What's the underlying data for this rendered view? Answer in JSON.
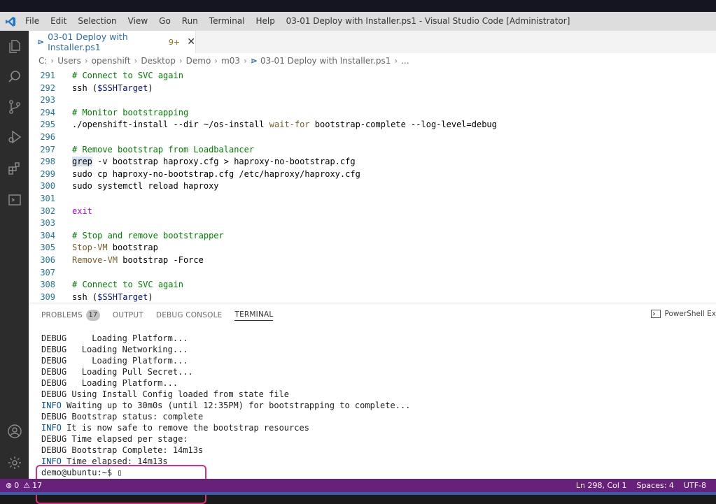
{
  "window": {
    "title": "03-01 Deploy with Installer.ps1 - Visual Studio Code [Administrator]",
    "menu": [
      "File",
      "Edit",
      "Selection",
      "View",
      "Go",
      "Run",
      "Terminal",
      "Help"
    ]
  },
  "activity_bar": {
    "items": [
      "explorer-icon",
      "search-icon",
      "source-control-icon",
      "run-debug-icon",
      "extensions-icon",
      "remote-terminal-icon"
    ],
    "bottom": [
      "accounts-icon",
      "manage-gear-icon"
    ]
  },
  "tab": {
    "ps_glyph": "⋗",
    "name": "03-01 Deploy with Installer.ps1",
    "badge": "9+",
    "close": "✕"
  },
  "breadcrumb": [
    "C:",
    "Users",
    "openshift",
    "Desktop",
    "Demo",
    "m03",
    "03-01 Deploy with Installer.ps1",
    "..."
  ],
  "code_lines": [
    {
      "n": "291",
      "segments": [
        {
          "t": "# Connect to SVC again",
          "c": "c-comment"
        }
      ]
    },
    {
      "n": "292",
      "segments": [
        {
          "t": "ssh (",
          "c": ""
        },
        {
          "t": "$SSHTarget",
          "c": "c-var"
        },
        {
          "t": ")",
          "c": ""
        }
      ]
    },
    {
      "n": "293",
      "segments": []
    },
    {
      "n": "294",
      "segments": [
        {
          "t": "# Monitor bootstrapping",
          "c": "c-comment"
        }
      ]
    },
    {
      "n": "295",
      "segments": [
        {
          "t": "./openshift-install --dir ~/os-install ",
          "c": ""
        },
        {
          "t": "wait-for",
          "c": "c-fn"
        },
        {
          "t": " bootstrap-complete --log-level=debug",
          "c": ""
        }
      ]
    },
    {
      "n": "296",
      "segments": []
    },
    {
      "n": "297",
      "segments": [
        {
          "t": "# Remove bootstrap from Loadbalancer",
          "c": "c-comment"
        }
      ]
    },
    {
      "n": "298",
      "segments": [
        {
          "t": "grep",
          "c": "hl"
        },
        {
          "t": " -v bootstrap haproxy.cfg > haproxy-no-bootstrap.cfg",
          "c": ""
        }
      ]
    },
    {
      "n": "299",
      "segments": [
        {
          "t": "sudo cp haproxy-no-bootstrap.cfg /etc/haproxy/haproxy.cfg",
          "c": ""
        }
      ]
    },
    {
      "n": "300",
      "segments": [
        {
          "t": "sudo systemctl reload haproxy",
          "c": ""
        }
      ]
    },
    {
      "n": "301",
      "segments": []
    },
    {
      "n": "302",
      "segments": [
        {
          "t": "exit",
          "c": "c-kw"
        }
      ]
    },
    {
      "n": "303",
      "segments": []
    },
    {
      "n": "304",
      "segments": [
        {
          "t": "# Stop and remove bootstrapper",
          "c": "c-comment"
        }
      ]
    },
    {
      "n": "305",
      "segments": [
        {
          "t": "Stop-VM",
          "c": "c-fn"
        },
        {
          "t": " bootstrap",
          "c": ""
        }
      ]
    },
    {
      "n": "306",
      "segments": [
        {
          "t": "Remove-VM",
          "c": "c-fn"
        },
        {
          "t": " bootstrap -Force",
          "c": ""
        }
      ]
    },
    {
      "n": "307",
      "segments": []
    },
    {
      "n": "308",
      "segments": [
        {
          "t": "# Connect to SVC again",
          "c": "c-comment"
        }
      ]
    },
    {
      "n": "309",
      "segments": [
        {
          "t": "ssh (",
          "c": ""
        },
        {
          "t": "$SSHTarget",
          "c": "c-var"
        },
        {
          "t": ")",
          "c": ""
        }
      ]
    }
  ],
  "panel": {
    "tabs": [
      {
        "label": "PROBLEMS",
        "count": "17"
      },
      {
        "label": "OUTPUT"
      },
      {
        "label": "DEBUG CONSOLE"
      },
      {
        "label": "TERMINAL",
        "active": true
      }
    ],
    "shell_label": "PowerShell Ex"
  },
  "terminal_lines": [
    {
      "level": "DEBUG",
      "text": "     Loading Platform..."
    },
    {
      "level": "DEBUG",
      "text": "   Loading Networking..."
    },
    {
      "level": "DEBUG",
      "text": "     Loading Platform..."
    },
    {
      "level": "DEBUG",
      "text": "   Loading Pull Secret..."
    },
    {
      "level": "DEBUG",
      "text": "   Loading Platform..."
    },
    {
      "level": "DEBUG",
      "text": " Using Install Config loaded from state file"
    },
    {
      "level": "INFO",
      "text": " Waiting up to 30m0s (until 12:35PM) for bootstrapping to complete..."
    },
    {
      "level": "DEBUG",
      "text": " Bootstrap status: complete"
    },
    {
      "level": "INFO",
      "text": " It is now safe to remove the bootstrap resources"
    },
    {
      "level": "DEBUG",
      "text": " Time elapsed per stage:"
    },
    {
      "level": "DEBUG",
      "text": " Bootstrap Complete: 14m13s"
    },
    {
      "level": "INFO",
      "text": " Time elapsed: 14m13s"
    },
    {
      "level": "",
      "text": "demo@ubuntu:~$ ▯"
    }
  ],
  "status": {
    "errors": "0",
    "warnings": "17",
    "position": "Ln 298, Col 1",
    "spaces": "Spaces: 4",
    "encoding": "UTF-8"
  },
  "colors": {
    "status_bar": "#68217a",
    "highlight_box": "#d8337a",
    "accent_tab": "#2f6db5"
  }
}
